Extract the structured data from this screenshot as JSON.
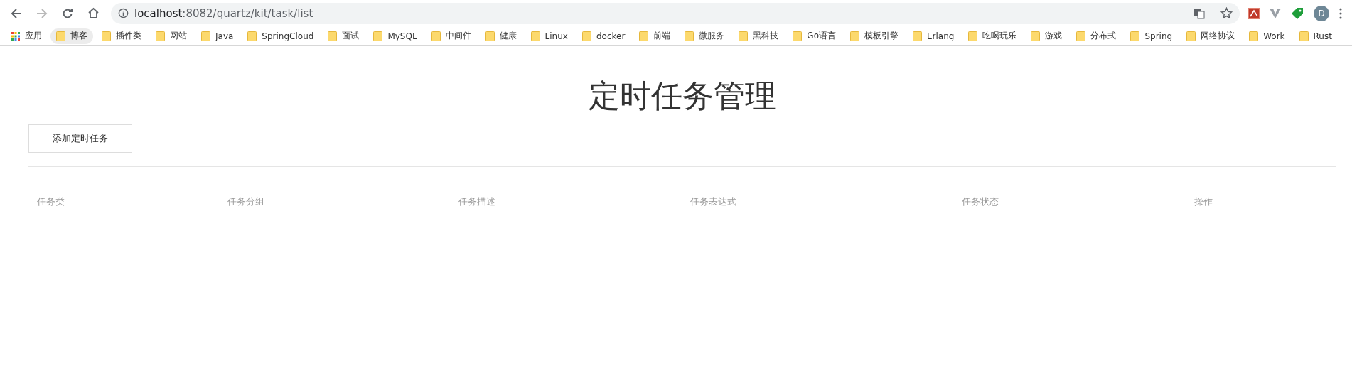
{
  "browser": {
    "forward_disabled": true,
    "url_host": "localhost",
    "url_rest": ":8082/quartz/kit/task/list",
    "avatar": "D",
    "apps_label": "应用",
    "bookmarks": [
      {
        "label": "博客",
        "highlighted": true
      },
      {
        "label": "插件类",
        "highlighted": false
      },
      {
        "label": "网站",
        "highlighted": false
      },
      {
        "label": "Java",
        "highlighted": false
      },
      {
        "label": "SpringCloud",
        "highlighted": false
      },
      {
        "label": "面试",
        "highlighted": false
      },
      {
        "label": "MySQL",
        "highlighted": false
      },
      {
        "label": "中间件",
        "highlighted": false
      },
      {
        "label": "健康",
        "highlighted": false
      },
      {
        "label": "Linux",
        "highlighted": false
      },
      {
        "label": "docker",
        "highlighted": false
      },
      {
        "label": "前端",
        "highlighted": false
      },
      {
        "label": "微服务",
        "highlighted": false
      },
      {
        "label": "黑科技",
        "highlighted": false
      },
      {
        "label": "Go语言",
        "highlighted": false
      },
      {
        "label": "模板引擎",
        "highlighted": false
      },
      {
        "label": "Erlang",
        "highlighted": false
      },
      {
        "label": "吃喝玩乐",
        "highlighted": false
      },
      {
        "label": "游戏",
        "highlighted": false
      },
      {
        "label": "分布式",
        "highlighted": false
      },
      {
        "label": "Spring",
        "highlighted": false
      },
      {
        "label": "网络协议",
        "highlighted": false
      },
      {
        "label": "Work",
        "highlighted": false
      },
      {
        "label": "Rust",
        "highlighted": false
      }
    ]
  },
  "page": {
    "title": "定时任务管理",
    "add_button": "添加定时任务",
    "table": {
      "columns": [
        "任务类",
        "任务分组",
        "任务描述",
        "任务表达式",
        "任务状态",
        "操作"
      ]
    }
  }
}
